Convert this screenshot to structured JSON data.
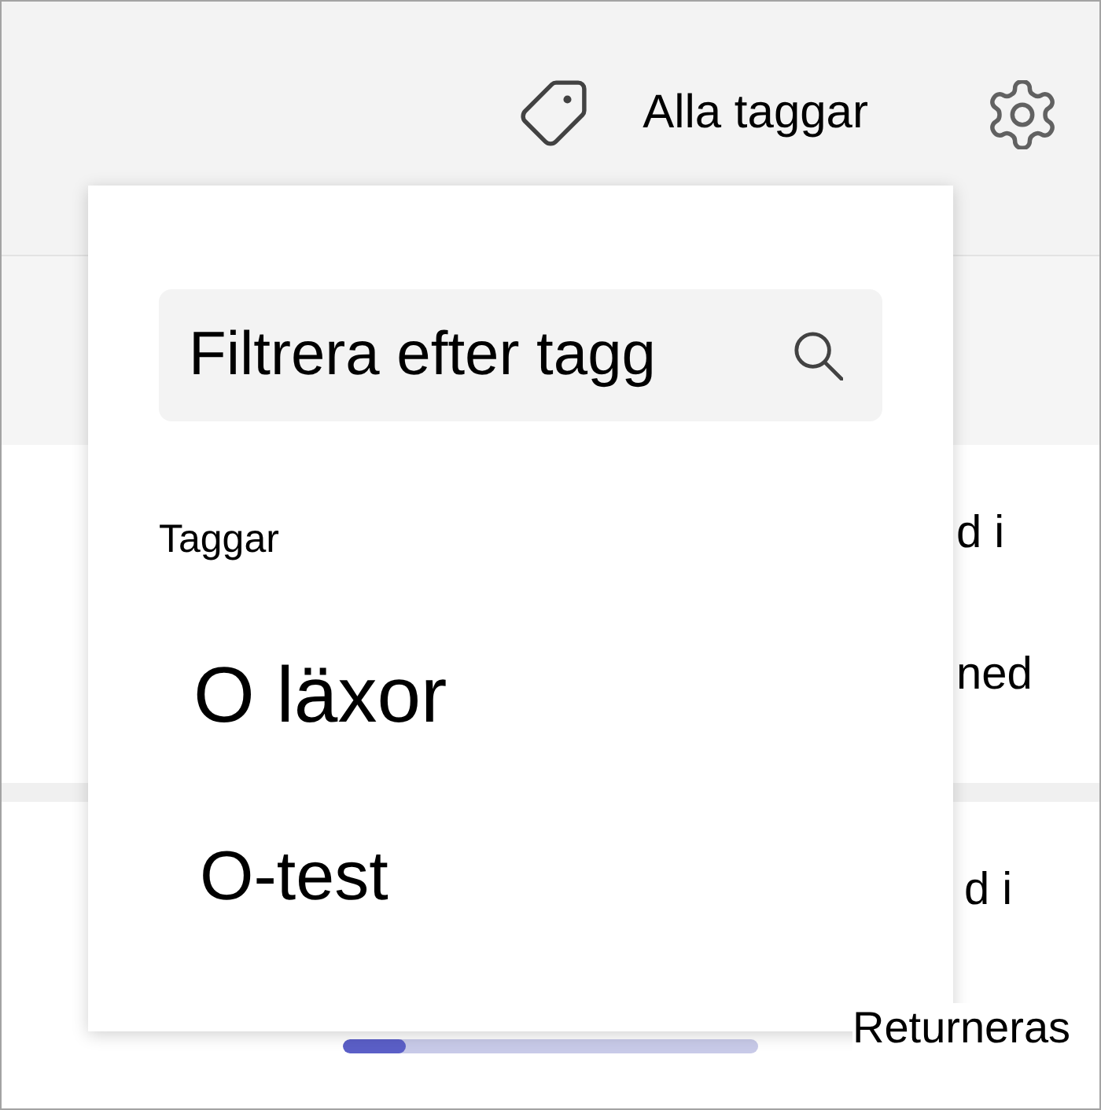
{
  "toolbar": {
    "tag_filter": {
      "label": "Alla taggar"
    }
  },
  "tag_menu": {
    "search": {
      "placeholder": "Filtrera efter tagg"
    },
    "section_label": "Taggar",
    "items": [
      {
        "label": "O läxor"
      },
      {
        "label": "O-test"
      }
    ]
  },
  "rows": [
    {
      "column_texts": [
        "d i",
        "ned"
      ]
    },
    {
      "column_texts": [
        "d i"
      ],
      "progress": {
        "level": 0.15
      },
      "status": "Returneras"
    }
  ]
}
